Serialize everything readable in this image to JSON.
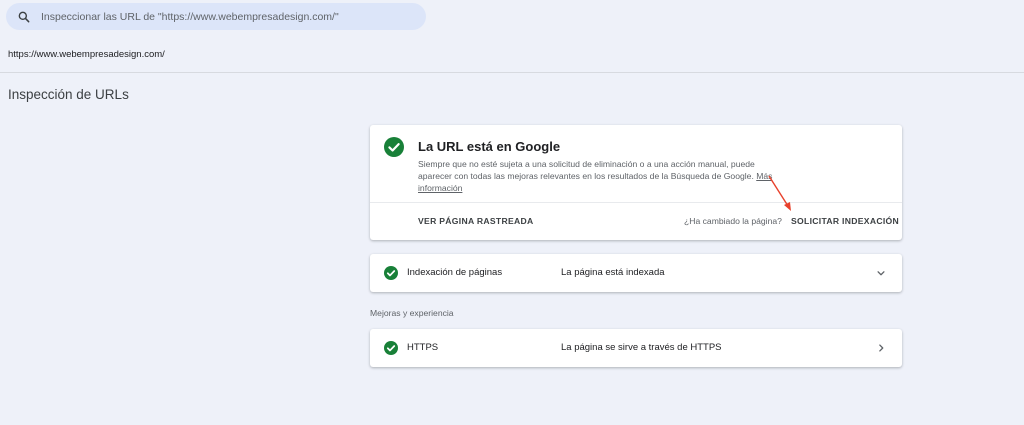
{
  "search": {
    "placeholder": "Inspeccionar las URL de \"https://www.webempresadesign.com/\"",
    "icon": "search-icon"
  },
  "breadcrumb": {
    "url": "https://www.webempresadesign.com/"
  },
  "page": {
    "title": "Inspección de URLs"
  },
  "status_card": {
    "icon": "check-circle-icon",
    "title": "La URL está en Google",
    "description": "Siempre que no esté sujeta a una solicitud de eliminación o a una acción manual, puede aparecer con todas las mejoras relevantes en los resultados de la Búsqueda de Google.",
    "more_info_link": "Más información",
    "view_crawled_label": "VER PÁGINA RASTREADA",
    "changed_question": "¿Ha cambiado la página?",
    "request_indexing_label": "SOLICITAR INDEXACIÓN"
  },
  "indexing_row": {
    "label": "Indexación de páginas",
    "value": "La página está indexada",
    "chevron": "chevron-down-icon"
  },
  "section": {
    "label": "Mejoras y experiencia"
  },
  "https_row": {
    "label": "HTTPS",
    "value": "La página se sirve a través de HTTPS",
    "chevron": "chevron-right-icon"
  },
  "colors": {
    "background": "#eef1f9",
    "search_bg": "#dce5f9",
    "success_green": "#188038",
    "annotation_red": "#e8412c"
  }
}
